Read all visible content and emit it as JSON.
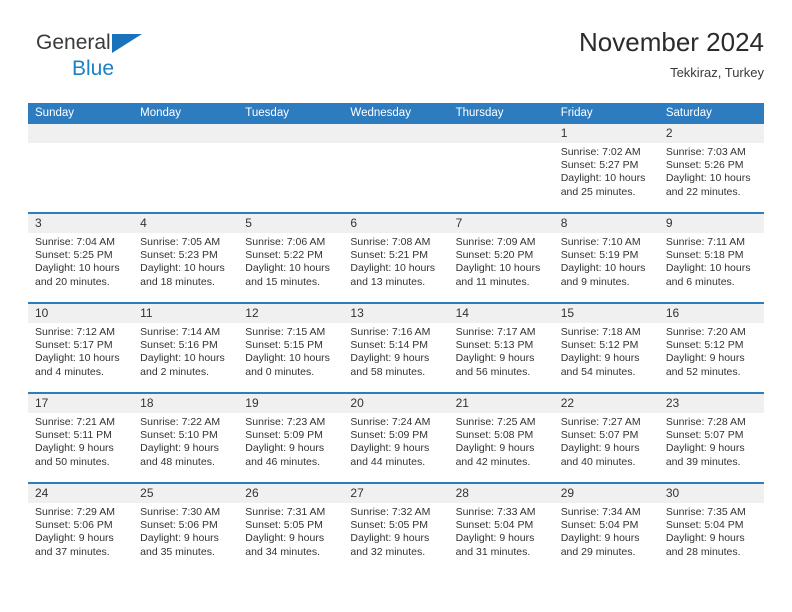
{
  "brand": {
    "name_part1": "General",
    "name_part2": "Blue"
  },
  "header": {
    "title": "November 2024",
    "subtitle": "Tekkiraz, Turkey"
  },
  "colors": {
    "header_blue": "#2e7cc0",
    "logo_blue": "#1a81c7",
    "day_band": "#f0f0f0",
    "text": "#333333"
  },
  "weekdays": [
    "Sunday",
    "Monday",
    "Tuesday",
    "Wednesday",
    "Thursday",
    "Friday",
    "Saturday"
  ],
  "labels": {
    "sunrise": "Sunrise:",
    "sunset": "Sunset:",
    "daylight": "Daylight:"
  },
  "weeks": [
    [
      {
        "day": "",
        "sunrise": "",
        "sunset": "",
        "daylight_line1": "",
        "daylight_line2": ""
      },
      {
        "day": "",
        "sunrise": "",
        "sunset": "",
        "daylight_line1": "",
        "daylight_line2": ""
      },
      {
        "day": "",
        "sunrise": "",
        "sunset": "",
        "daylight_line1": "",
        "daylight_line2": ""
      },
      {
        "day": "",
        "sunrise": "",
        "sunset": "",
        "daylight_line1": "",
        "daylight_line2": ""
      },
      {
        "day": "",
        "sunrise": "",
        "sunset": "",
        "daylight_line1": "",
        "daylight_line2": ""
      },
      {
        "day": "1",
        "sunrise": "Sunrise: 7:02 AM",
        "sunset": "Sunset: 5:27 PM",
        "daylight_line1": "Daylight: 10 hours",
        "daylight_line2": "and 25 minutes."
      },
      {
        "day": "2",
        "sunrise": "Sunrise: 7:03 AM",
        "sunset": "Sunset: 5:26 PM",
        "daylight_line1": "Daylight: 10 hours",
        "daylight_line2": "and 22 minutes."
      }
    ],
    [
      {
        "day": "3",
        "sunrise": "Sunrise: 7:04 AM",
        "sunset": "Sunset: 5:25 PM",
        "daylight_line1": "Daylight: 10 hours",
        "daylight_line2": "and 20 minutes."
      },
      {
        "day": "4",
        "sunrise": "Sunrise: 7:05 AM",
        "sunset": "Sunset: 5:23 PM",
        "daylight_line1": "Daylight: 10 hours",
        "daylight_line2": "and 18 minutes."
      },
      {
        "day": "5",
        "sunrise": "Sunrise: 7:06 AM",
        "sunset": "Sunset: 5:22 PM",
        "daylight_line1": "Daylight: 10 hours",
        "daylight_line2": "and 15 minutes."
      },
      {
        "day": "6",
        "sunrise": "Sunrise: 7:08 AM",
        "sunset": "Sunset: 5:21 PM",
        "daylight_line1": "Daylight: 10 hours",
        "daylight_line2": "and 13 minutes."
      },
      {
        "day": "7",
        "sunrise": "Sunrise: 7:09 AM",
        "sunset": "Sunset: 5:20 PM",
        "daylight_line1": "Daylight: 10 hours",
        "daylight_line2": "and 11 minutes."
      },
      {
        "day": "8",
        "sunrise": "Sunrise: 7:10 AM",
        "sunset": "Sunset: 5:19 PM",
        "daylight_line1": "Daylight: 10 hours",
        "daylight_line2": "and 9 minutes."
      },
      {
        "day": "9",
        "sunrise": "Sunrise: 7:11 AM",
        "sunset": "Sunset: 5:18 PM",
        "daylight_line1": "Daylight: 10 hours",
        "daylight_line2": "and 6 minutes."
      }
    ],
    [
      {
        "day": "10",
        "sunrise": "Sunrise: 7:12 AM",
        "sunset": "Sunset: 5:17 PM",
        "daylight_line1": "Daylight: 10 hours",
        "daylight_line2": "and 4 minutes."
      },
      {
        "day": "11",
        "sunrise": "Sunrise: 7:14 AM",
        "sunset": "Sunset: 5:16 PM",
        "daylight_line1": "Daylight: 10 hours",
        "daylight_line2": "and 2 minutes."
      },
      {
        "day": "12",
        "sunrise": "Sunrise: 7:15 AM",
        "sunset": "Sunset: 5:15 PM",
        "daylight_line1": "Daylight: 10 hours",
        "daylight_line2": "and 0 minutes."
      },
      {
        "day": "13",
        "sunrise": "Sunrise: 7:16 AM",
        "sunset": "Sunset: 5:14 PM",
        "daylight_line1": "Daylight: 9 hours",
        "daylight_line2": "and 58 minutes."
      },
      {
        "day": "14",
        "sunrise": "Sunrise: 7:17 AM",
        "sunset": "Sunset: 5:13 PM",
        "daylight_line1": "Daylight: 9 hours",
        "daylight_line2": "and 56 minutes."
      },
      {
        "day": "15",
        "sunrise": "Sunrise: 7:18 AM",
        "sunset": "Sunset: 5:12 PM",
        "daylight_line1": "Daylight: 9 hours",
        "daylight_line2": "and 54 minutes."
      },
      {
        "day": "16",
        "sunrise": "Sunrise: 7:20 AM",
        "sunset": "Sunset: 5:12 PM",
        "daylight_line1": "Daylight: 9 hours",
        "daylight_line2": "and 52 minutes."
      }
    ],
    [
      {
        "day": "17",
        "sunrise": "Sunrise: 7:21 AM",
        "sunset": "Sunset: 5:11 PM",
        "daylight_line1": "Daylight: 9 hours",
        "daylight_line2": "and 50 minutes."
      },
      {
        "day": "18",
        "sunrise": "Sunrise: 7:22 AM",
        "sunset": "Sunset: 5:10 PM",
        "daylight_line1": "Daylight: 9 hours",
        "daylight_line2": "and 48 minutes."
      },
      {
        "day": "19",
        "sunrise": "Sunrise: 7:23 AM",
        "sunset": "Sunset: 5:09 PM",
        "daylight_line1": "Daylight: 9 hours",
        "daylight_line2": "and 46 minutes."
      },
      {
        "day": "20",
        "sunrise": "Sunrise: 7:24 AM",
        "sunset": "Sunset: 5:09 PM",
        "daylight_line1": "Daylight: 9 hours",
        "daylight_line2": "and 44 minutes."
      },
      {
        "day": "21",
        "sunrise": "Sunrise: 7:25 AM",
        "sunset": "Sunset: 5:08 PM",
        "daylight_line1": "Daylight: 9 hours",
        "daylight_line2": "and 42 minutes."
      },
      {
        "day": "22",
        "sunrise": "Sunrise: 7:27 AM",
        "sunset": "Sunset: 5:07 PM",
        "daylight_line1": "Daylight: 9 hours",
        "daylight_line2": "and 40 minutes."
      },
      {
        "day": "23",
        "sunrise": "Sunrise: 7:28 AM",
        "sunset": "Sunset: 5:07 PM",
        "daylight_line1": "Daylight: 9 hours",
        "daylight_line2": "and 39 minutes."
      }
    ],
    [
      {
        "day": "24",
        "sunrise": "Sunrise: 7:29 AM",
        "sunset": "Sunset: 5:06 PM",
        "daylight_line1": "Daylight: 9 hours",
        "daylight_line2": "and 37 minutes."
      },
      {
        "day": "25",
        "sunrise": "Sunrise: 7:30 AM",
        "sunset": "Sunset: 5:06 PM",
        "daylight_line1": "Daylight: 9 hours",
        "daylight_line2": "and 35 minutes."
      },
      {
        "day": "26",
        "sunrise": "Sunrise: 7:31 AM",
        "sunset": "Sunset: 5:05 PM",
        "daylight_line1": "Daylight: 9 hours",
        "daylight_line2": "and 34 minutes."
      },
      {
        "day": "27",
        "sunrise": "Sunrise: 7:32 AM",
        "sunset": "Sunset: 5:05 PM",
        "daylight_line1": "Daylight: 9 hours",
        "daylight_line2": "and 32 minutes."
      },
      {
        "day": "28",
        "sunrise": "Sunrise: 7:33 AM",
        "sunset": "Sunset: 5:04 PM",
        "daylight_line1": "Daylight: 9 hours",
        "daylight_line2": "and 31 minutes."
      },
      {
        "day": "29",
        "sunrise": "Sunrise: 7:34 AM",
        "sunset": "Sunset: 5:04 PM",
        "daylight_line1": "Daylight: 9 hours",
        "daylight_line2": "and 29 minutes."
      },
      {
        "day": "30",
        "sunrise": "Sunrise: 7:35 AM",
        "sunset": "Sunset: 5:04 PM",
        "daylight_line1": "Daylight: 9 hours",
        "daylight_line2": "and 28 minutes."
      }
    ]
  ]
}
